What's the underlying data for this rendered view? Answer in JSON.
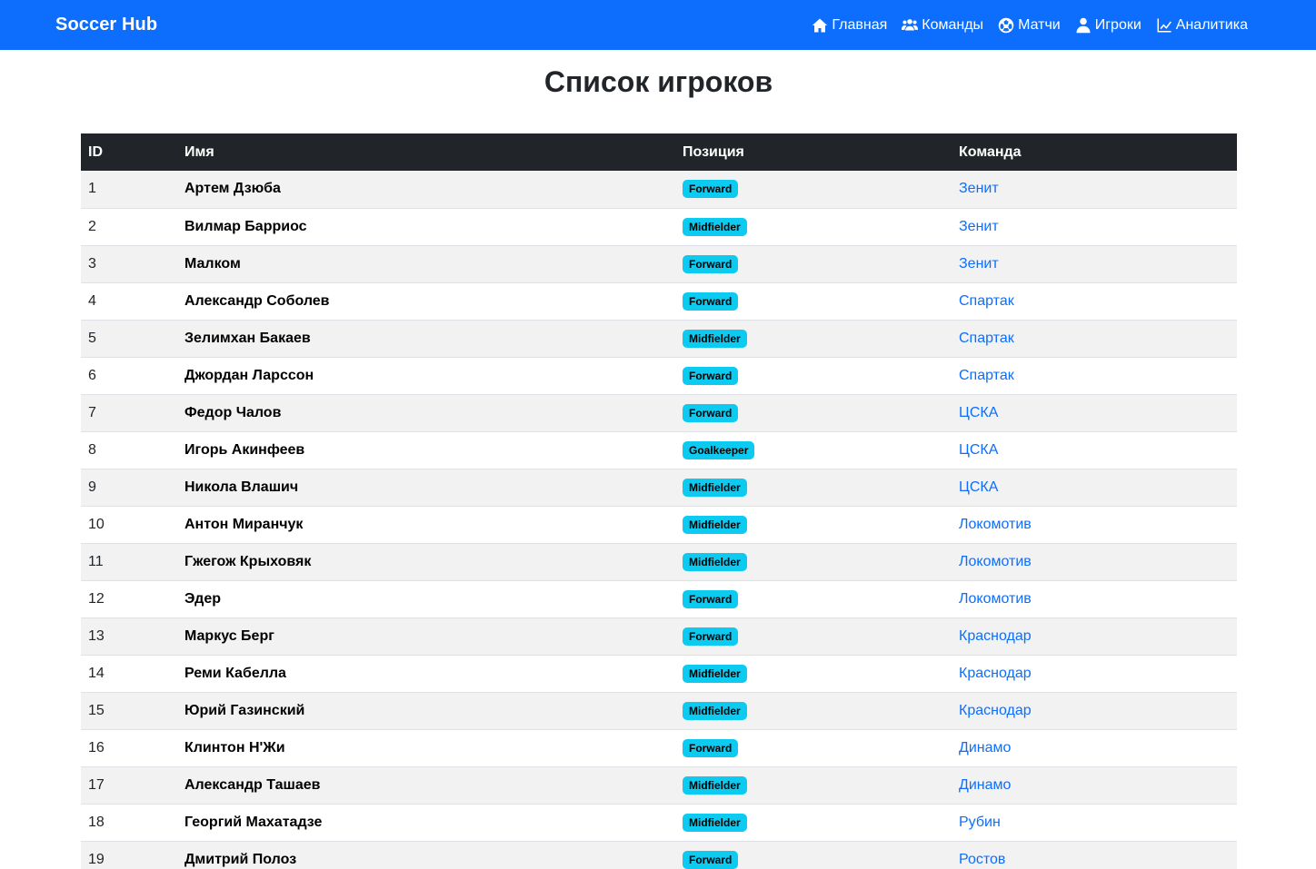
{
  "brand": "Soccer Hub",
  "nav": [
    {
      "label": "Главная",
      "icon": "home-icon"
    },
    {
      "label": "Команды",
      "icon": "users-icon"
    },
    {
      "label": "Матчи",
      "icon": "soccer-ball-icon"
    },
    {
      "label": "Игроки",
      "icon": "user-icon"
    },
    {
      "label": "Аналитика",
      "icon": "chart-line-icon"
    }
  ],
  "page_title": "Список игроков",
  "table": {
    "headers": [
      "ID",
      "Имя",
      "Позиция",
      "Команда"
    ],
    "rows": [
      {
        "id": "1",
        "name": "Артем Дзюба",
        "position": "Forward",
        "team": "Зенит"
      },
      {
        "id": "2",
        "name": "Вилмар Барриос",
        "position": "Midfielder",
        "team": "Зенит"
      },
      {
        "id": "3",
        "name": "Малком",
        "position": "Forward",
        "team": "Зенит"
      },
      {
        "id": "4",
        "name": "Александр Соболев",
        "position": "Forward",
        "team": "Спартак"
      },
      {
        "id": "5",
        "name": "Зелимхан Бакаев",
        "position": "Midfielder",
        "team": "Спартак"
      },
      {
        "id": "6",
        "name": "Джордан Ларссон",
        "position": "Forward",
        "team": "Спартак"
      },
      {
        "id": "7",
        "name": "Федор Чалов",
        "position": "Forward",
        "team": "ЦСКА"
      },
      {
        "id": "8",
        "name": "Игорь Акинфеев",
        "position": "Goalkeeper",
        "team": "ЦСКА"
      },
      {
        "id": "9",
        "name": "Никола Влашич",
        "position": "Midfielder",
        "team": "ЦСКА"
      },
      {
        "id": "10",
        "name": "Антон Миранчук",
        "position": "Midfielder",
        "team": "Локомотив"
      },
      {
        "id": "11",
        "name": "Гжегож Крыховяк",
        "position": "Midfielder",
        "team": "Локомотив"
      },
      {
        "id": "12",
        "name": "Эдер",
        "position": "Forward",
        "team": "Локомотив"
      },
      {
        "id": "13",
        "name": "Маркус Берг",
        "position": "Forward",
        "team": "Краснодар"
      },
      {
        "id": "14",
        "name": "Реми Кабелла",
        "position": "Midfielder",
        "team": "Краснодар"
      },
      {
        "id": "15",
        "name": "Юрий Газинский",
        "position": "Midfielder",
        "team": "Краснодар"
      },
      {
        "id": "16",
        "name": "Клинтон Н'Жи",
        "position": "Forward",
        "team": "Динамо"
      },
      {
        "id": "17",
        "name": "Александр Ташаев",
        "position": "Midfielder",
        "team": "Динамо"
      },
      {
        "id": "18",
        "name": "Георгий Махатадзе",
        "position": "Midfielder",
        "team": "Рубин"
      },
      {
        "id": "19",
        "name": "Дмитрий Полоз",
        "position": "Forward",
        "team": "Ростов"
      }
    ]
  },
  "colors": {
    "navbar": "#0d6efd",
    "table_header": "#212529",
    "badge": "#0dcaf0",
    "link": "#0d6efd"
  }
}
